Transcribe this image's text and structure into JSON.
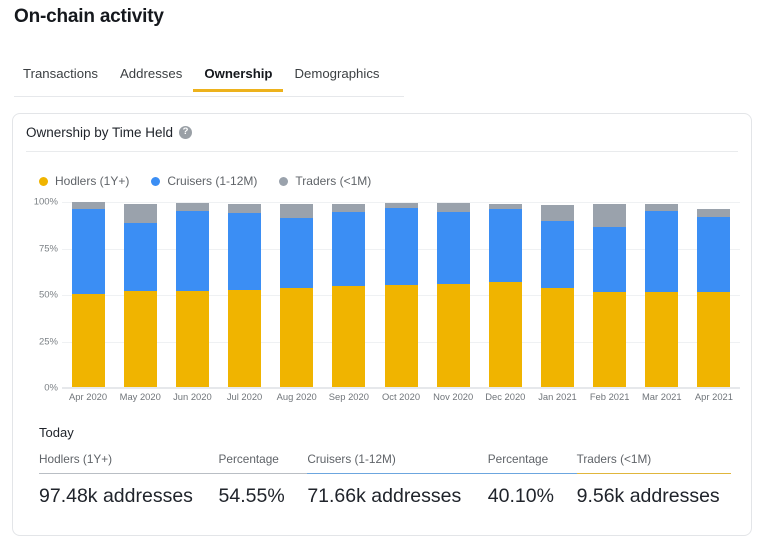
{
  "header": {
    "title": "On-chain activity"
  },
  "tabs": [
    {
      "label": "Transactions",
      "active": false
    },
    {
      "label": "Addresses",
      "active": false
    },
    {
      "label": "Ownership",
      "active": true
    },
    {
      "label": "Demographics",
      "active": false
    }
  ],
  "card": {
    "title": "Ownership by Time Held",
    "help_icon": "help-circle-icon",
    "help_glyph": "?"
  },
  "colors": {
    "hodlers": "#F0B400",
    "cruisers": "#3B8EF4",
    "traders": "#9AA2AC",
    "accent": "#EDB21C",
    "grid": "#EFF1F3",
    "axis_text": "#70757A"
  },
  "legend": [
    {
      "label": "Hodlers (1Y+)",
      "color": "#F0B400"
    },
    {
      "label": "Cruisers (1-12M)",
      "color": "#3B8EF4"
    },
    {
      "label": "Traders (<1M)",
      "color": "#9AA2AC"
    }
  ],
  "today": {
    "label": "Today",
    "stats": [
      {
        "header": "Hodlers (1Y+)",
        "value": "97.48k addresses",
        "underline": "#B9BEC4",
        "width_class": "w-hodlers"
      },
      {
        "header": "Percentage",
        "value": "54.55%",
        "underline": "#B9BEC4",
        "width_class": "w-pct1"
      },
      {
        "header": "Cruisers (1-12M)",
        "value": "71.66k addresses",
        "underline": "#6CA6DF",
        "width_class": "w-cruisers"
      },
      {
        "header": "Percentage",
        "value": "40.10%",
        "underline": "#6CA6DF",
        "width_class": "w-pct2"
      },
      {
        "header": "Traders (<1M)",
        "value": "9.56k addresses",
        "underline": "#E3B githubusercontent",
        "width_class": "w-traders"
      }
    ]
  },
  "chart_data": {
    "type": "bar",
    "stacked": true,
    "title": "Ownership by Time Held",
    "xlabel": "",
    "ylabel": "",
    "ylim": [
      0,
      100
    ],
    "yticks": [
      "0%",
      "25%",
      "50%",
      "75%",
      "100%"
    ],
    "ytick_values": [
      0,
      25,
      50,
      75,
      100
    ],
    "grid": true,
    "legend_position": "top-left",
    "categories": [
      "Apr 2020",
      "May 2020",
      "Jun 2020",
      "Jul 2020",
      "Aug 2020",
      "Sep 2020",
      "Oct 2020",
      "Nov 2020",
      "Dec 2020",
      "Jan 2021",
      "Feb 2021",
      "Mar 2021",
      "Apr 2021"
    ],
    "series": [
      {
        "name": "Hodlers (1Y+)",
        "color": "#F0B400",
        "values": [
          50.0,
          51.5,
          51.5,
          52.0,
          53.0,
          54.5,
          55.0,
          55.5,
          56.5,
          53.0,
          51.0,
          51.0,
          51.0
        ]
      },
      {
        "name": "Cruisers (1-12M)",
        "color": "#3B8EF4",
        "values": [
          46.0,
          36.5,
          43.0,
          41.5,
          38.0,
          39.5,
          41.5,
          38.5,
          39.0,
          36.5,
          35.0,
          43.5,
          40.5
        ]
      },
      {
        "name": "Traders (<1M)",
        "color": "#9AA2AC",
        "values": [
          3.5,
          10.5,
          4.5,
          5.0,
          7.5,
          4.5,
          2.5,
          5.0,
          3.0,
          8.5,
          12.5,
          4.0,
          4.0
        ]
      }
    ]
  }
}
